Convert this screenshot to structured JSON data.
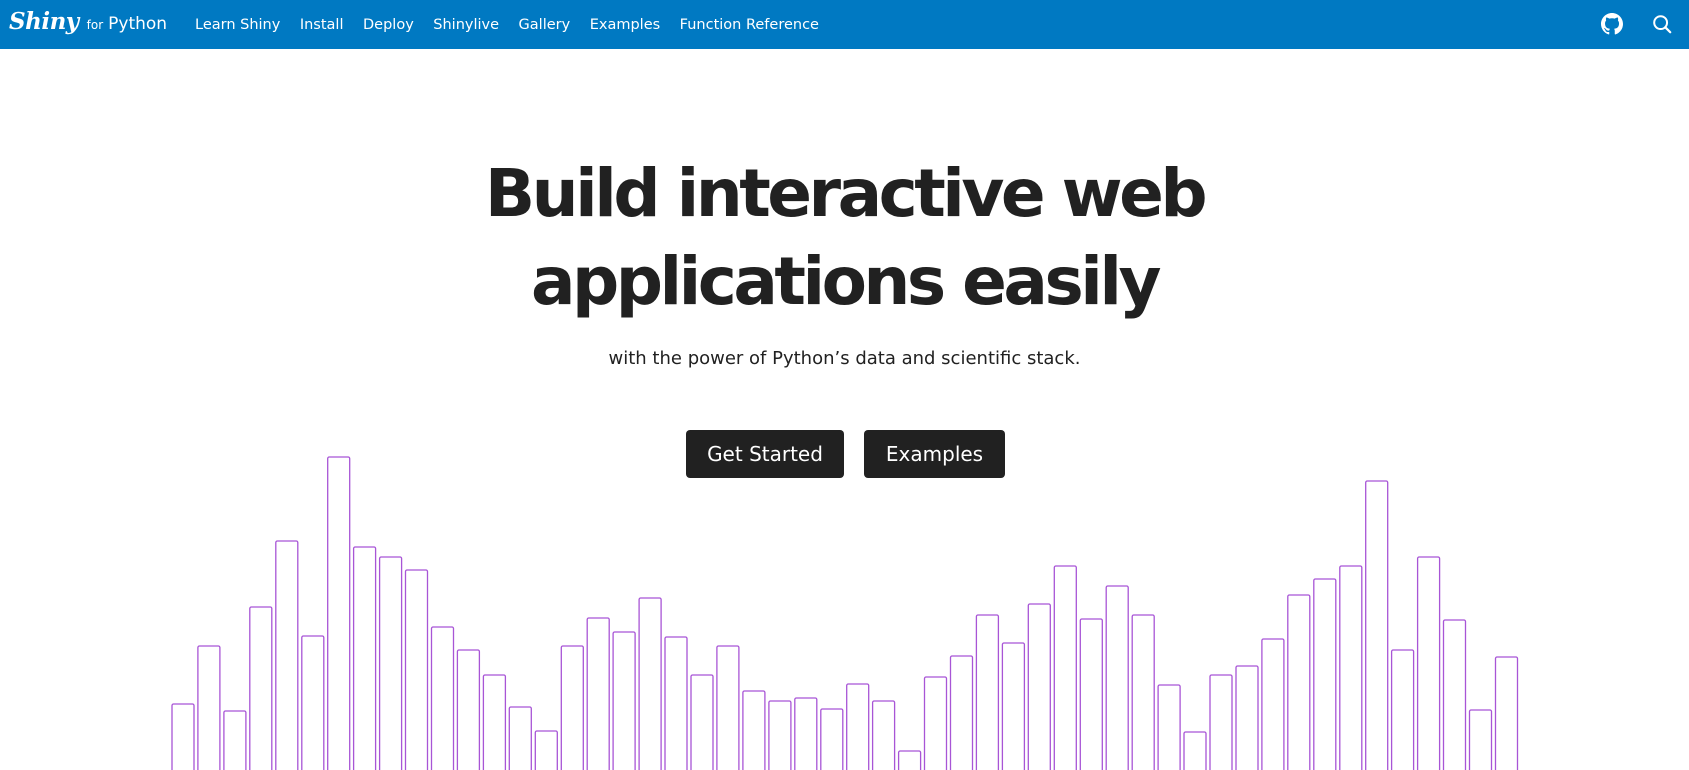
{
  "header": {
    "brand": {
      "script": "Shiny",
      "for": "for",
      "python": "Python"
    },
    "nav": [
      "Learn Shiny",
      "Install",
      "Deploy",
      "Shinylive",
      "Gallery",
      "Examples",
      "Function Reference"
    ],
    "icons": [
      "github-icon",
      "search-icon"
    ],
    "background": "#0079c2"
  },
  "hero": {
    "title_line1": "Build interactive web",
    "title_line2": "applications easily",
    "subtitle": "with the power of Python’s data and scientific stack.",
    "buttons": {
      "primary": "Get Started",
      "secondary": "Examples"
    }
  },
  "decoration": {
    "bar_color": "#a855d6",
    "bar_values": [
      68,
      126,
      61,
      165,
      231,
      136,
      315,
      225,
      215,
      202,
      145,
      122,
      97,
      65,
      41,
      126,
      154,
      140,
      174,
      135,
      97,
      126,
      81,
      71,
      74,
      63,
      88,
      71,
      21,
      95,
      116,
      157,
      129,
      168,
      206,
      153,
      186,
      157,
      87,
      40,
      97,
      106,
      133,
      177,
      193,
      206,
      291,
      122,
      215,
      152,
      62,
      115
    ]
  }
}
